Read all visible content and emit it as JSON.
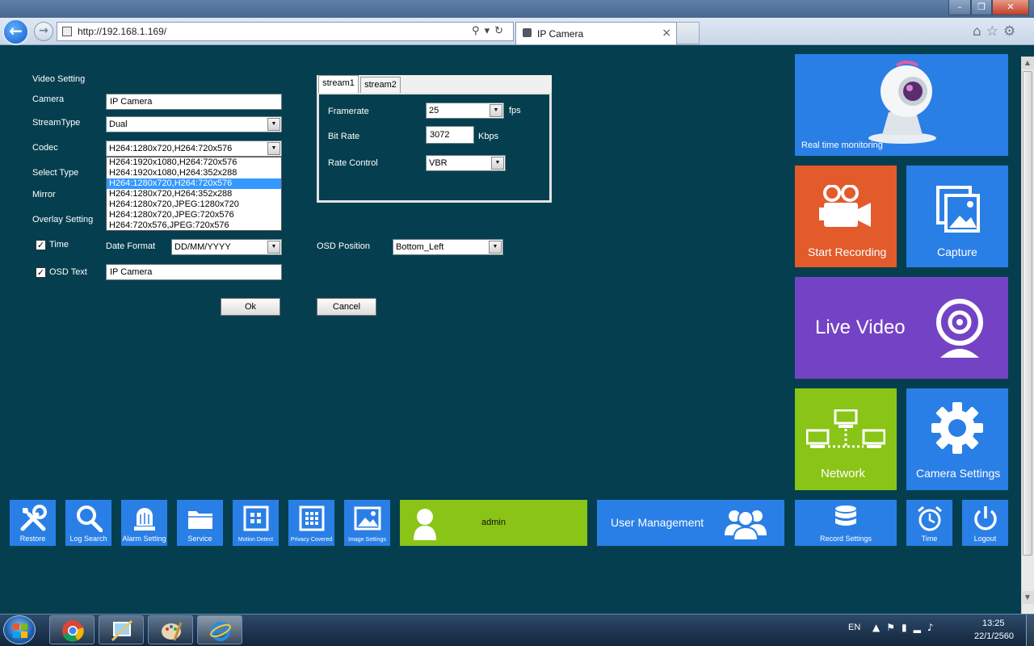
{
  "browser": {
    "url_prefix": "http://",
    "url_host": "192.168.1.169/",
    "tab_title": "IP Camera",
    "tab_close": "×",
    "window_minimize": "–",
    "window_maximize": "❐",
    "window_close": "✕"
  },
  "form": {
    "section_title": "Video Setting",
    "camera_label": "Camera",
    "camera_value": "IP Camera",
    "streamtype_label": "StreamType",
    "streamtype_value": "Dual",
    "codec_label": "Codec",
    "codec_value": "H264:1280x720,H264:720x576",
    "codec_options": [
      "H264:1920x1080,H264:720x576",
      "H264:1920x1080,H264:352x288",
      "H264:1280x720,H264:720x576",
      "H264:1280x720,H264:352x288",
      "H264:1280x720,JPEG:1280x720",
      "H264:1280x720,JPEG:720x576",
      "H264:720x576,JPEG:720x576"
    ],
    "codec_selected_index": 2,
    "select_type_label": "Select Type",
    "mirror_label": "Mirror",
    "overlay_label": "Overlay Setting",
    "time_label": "Time",
    "time_checked": true,
    "date_format_label": "Date Format",
    "date_format_value": "DD/MM/YYYY",
    "osd_position_label": "OSD Position",
    "osd_position_value": "Bottom_Left",
    "osd_text_label": "OSD Text",
    "osd_text_checked": true,
    "osd_text_value": "IP Camera",
    "ok_label": "Ok",
    "cancel_label": "Cancel"
  },
  "stream": {
    "tabs": [
      "stream1",
      "stream2"
    ],
    "active_tab": 0,
    "framerate_label": "Framerate",
    "framerate_value": "25",
    "framerate_unit": "fps",
    "bitrate_label": "Bit Rate",
    "bitrate_value": "3072",
    "bitrate_unit": "Kbps",
    "rate_control_label": "Rate Control",
    "rate_control_value": "VBR"
  },
  "tiles": {
    "realtime": "Real time monitoring",
    "start_recording": "Start Recording",
    "capture": "Capture",
    "live_video": "Live Video",
    "network": "Network",
    "camera_settings": "Camera Settings"
  },
  "bottom_bar": {
    "restore": "Restore",
    "log_search": "Log Search",
    "alarm_setting": "Alarm Setting",
    "service": "Service",
    "motion_detect": "Motion Detect",
    "privacy_covered": "Privacy Covered",
    "image_settings": "Image Settings",
    "user_name": "admin",
    "user_management": "User Management",
    "record_settings": "Record Settings",
    "time": "Time",
    "logout": "Logout"
  },
  "colors": {
    "background": "#053f4f",
    "tile_blue": "#2a7fe6",
    "tile_orange": "#e35a2b",
    "tile_purple": "#7443c5",
    "tile_green": "#89c417"
  },
  "taskbar": {
    "language": "EN",
    "time": "13:25",
    "date": "22/1/2560"
  }
}
